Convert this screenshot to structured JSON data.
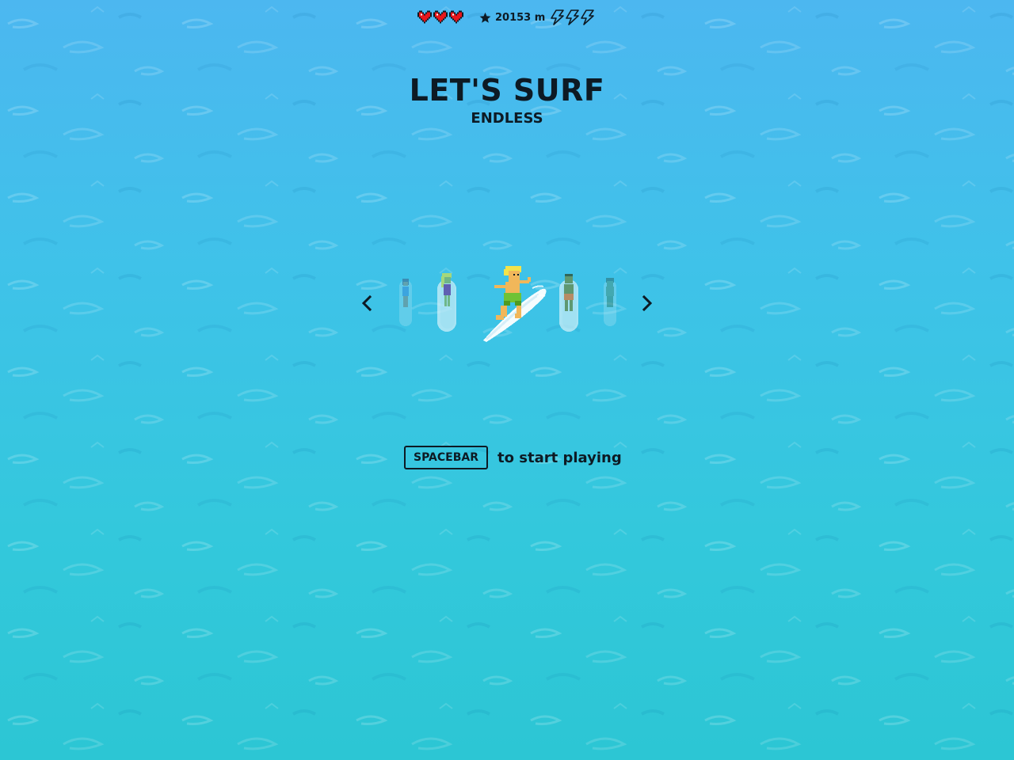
{
  "colors": {
    "text": "#0d1a24",
    "heart": "#e8161b",
    "water_top": "#4cb7f0",
    "water_bottom": "#2cc6d4"
  },
  "hud": {
    "lives": 3,
    "heart_icon": "heart-icon",
    "score_icon": "star-icon",
    "distance": "20153 m",
    "boosts": 3,
    "boost_icon": "lightning-bolt-icon"
  },
  "title": "LET'S SURF",
  "mode": "ENDLESS",
  "selector": {
    "prev_icon": "chevron-left-icon",
    "next_icon": "chevron-right-icon",
    "characters_visible": 5,
    "selected_index": 2
  },
  "prompt": {
    "key_label": "SPACEBAR",
    "text": "to start playing"
  }
}
